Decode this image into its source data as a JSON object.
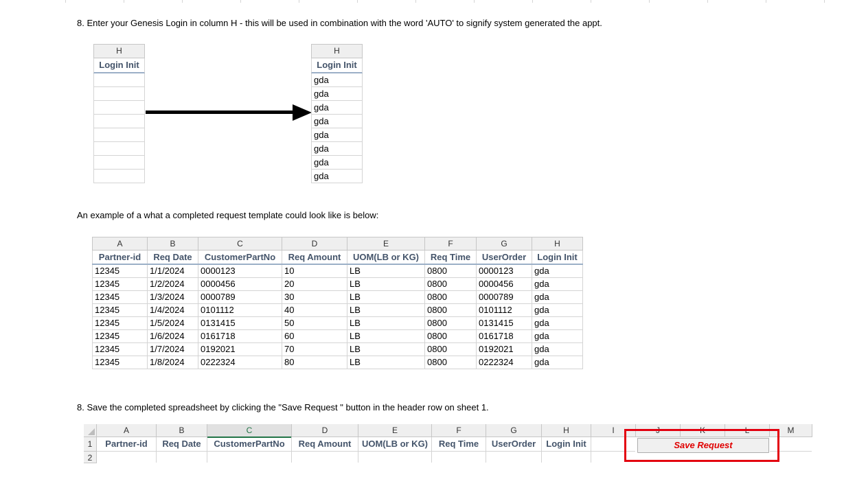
{
  "step8_login": "8. Enter your Genesis Login in column H - this will be used in combination with the word 'AUTO' to signify system generated the appt.",
  "left_table": {
    "column_letter": "H",
    "header": "Login Init",
    "values": [
      "",
      "",
      "",
      "",
      "",
      "",
      "",
      ""
    ]
  },
  "right_table": {
    "column_letter": "H",
    "header": "Login Init",
    "values": [
      "gda",
      "gda",
      "gda",
      "gda",
      "gda",
      "gda",
      "gda",
      "gda"
    ]
  },
  "example_intro": "An example of a what a completed request template could look like is below:",
  "example_table": {
    "column_letters": [
      "A",
      "B",
      "C",
      "D",
      "E",
      "F",
      "G",
      "H"
    ],
    "headers": [
      "Partner-id",
      "Req Date",
      "CustomerPartNo",
      "Req Amount",
      "UOM(LB or KG)",
      "Req Time",
      "UserOrder",
      "Login Init"
    ],
    "rows": [
      [
        "12345",
        "1/1/2024",
        "0000123",
        "10",
        "LB",
        "0800",
        "0000123",
        "gda"
      ],
      [
        "12345",
        "1/2/2024",
        "0000456",
        "20",
        "LB",
        "0800",
        "0000456",
        "gda"
      ],
      [
        "12345",
        "1/3/2024",
        "0000789",
        "30",
        "LB",
        "0800",
        "0000789",
        "gda"
      ],
      [
        "12345",
        "1/4/2024",
        "0101112",
        "40",
        "LB",
        "0800",
        "0101112",
        "gda"
      ],
      [
        "12345",
        "1/5/2024",
        "0131415",
        "50",
        "LB",
        "0800",
        "0131415",
        "gda"
      ],
      [
        "12345",
        "1/6/2024",
        "0161718",
        "60",
        "LB",
        "0800",
        "0161718",
        "gda"
      ],
      [
        "12345",
        "1/7/2024",
        "0192021",
        "70",
        "LB",
        "0800",
        "0192021",
        "gda"
      ],
      [
        "12345",
        "1/8/2024",
        "0222324",
        "80",
        "LB",
        "0800",
        "0222324",
        "gda"
      ]
    ]
  },
  "step8_save": "8. Save the completed spreadsheet by clicking the \"Save Request \" button in the header row on sheet 1.",
  "sheet_snippet": {
    "column_letters": [
      "A",
      "B",
      "C",
      "D",
      "E",
      "F",
      "G",
      "H",
      "I",
      "J",
      "K",
      "L",
      "M"
    ],
    "row_numbers": [
      "1",
      "2"
    ],
    "headers": [
      "Partner-id",
      "Req Date",
      "CustomerPartNo",
      "Req Amount",
      "UOM(LB or KG)",
      "Req Time",
      "UserOrder",
      "Login Init"
    ],
    "save_button_label": "Save Request",
    "highlight_color": "#e3000f",
    "save_label_color": "#e00000"
  }
}
